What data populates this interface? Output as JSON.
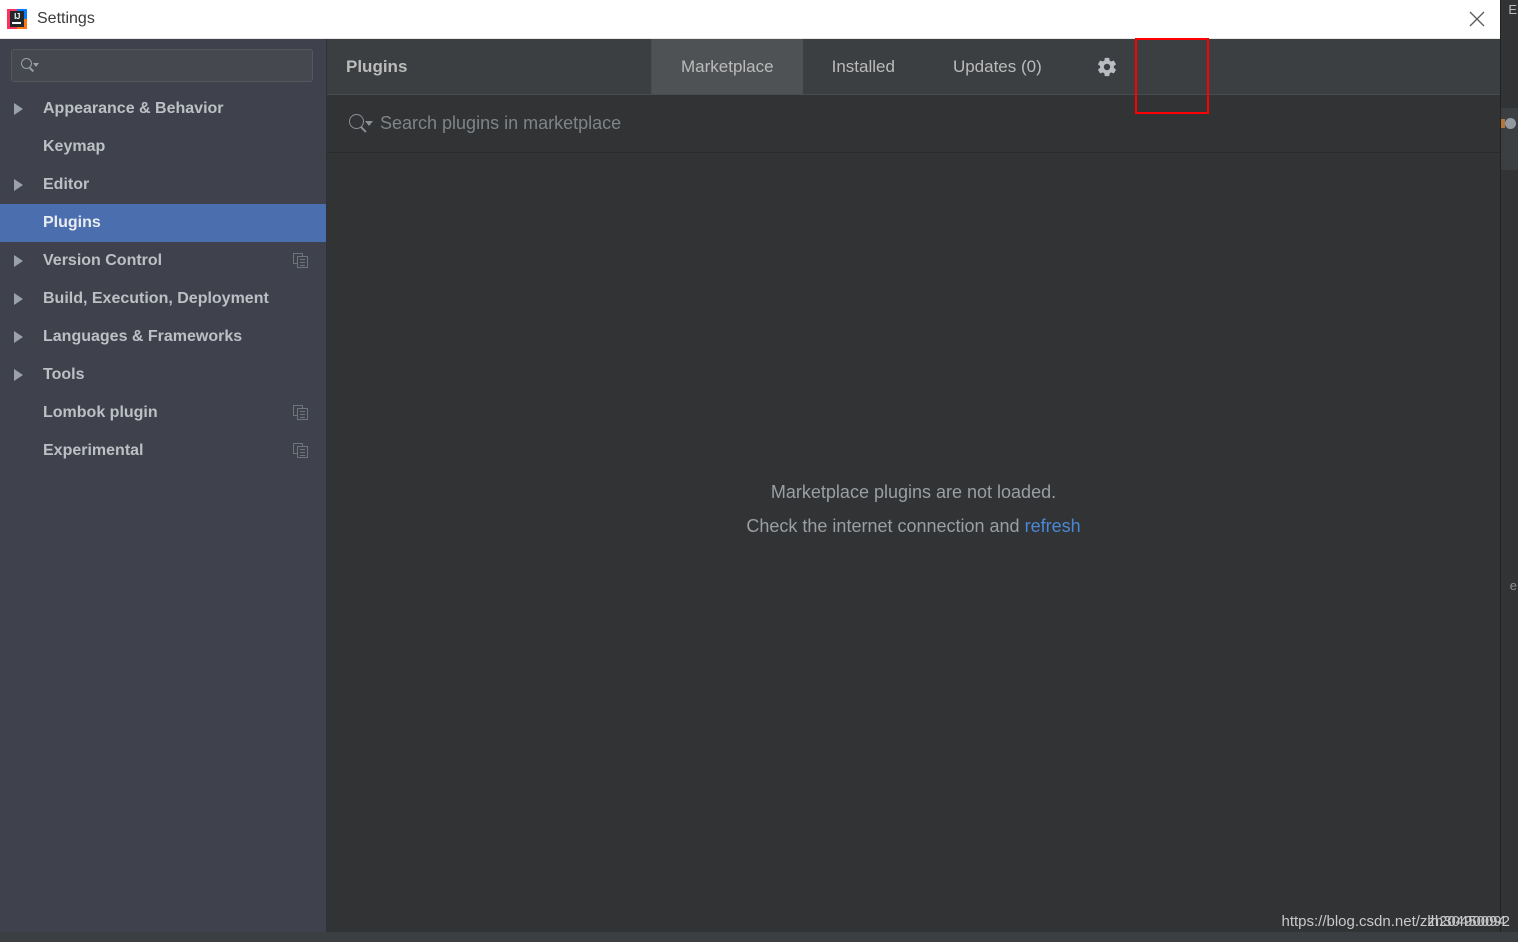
{
  "window": {
    "title": "Settings",
    "logo_icon": "intellij-idea-logo",
    "close_icon": "close-icon"
  },
  "sidebar": {
    "search": {
      "value": "",
      "placeholder": "",
      "icon": "search-icon"
    },
    "items": [
      {
        "label": "Appearance & Behavior",
        "expandable": true,
        "selected": false,
        "copy_icon": false
      },
      {
        "label": "Keymap",
        "expandable": false,
        "selected": false,
        "copy_icon": false
      },
      {
        "label": "Editor",
        "expandable": true,
        "selected": false,
        "copy_icon": false
      },
      {
        "label": "Plugins",
        "expandable": false,
        "selected": true,
        "copy_icon": false
      },
      {
        "label": "Version Control",
        "expandable": true,
        "selected": false,
        "copy_icon": true
      },
      {
        "label": "Build, Execution, Deployment",
        "expandable": true,
        "selected": false,
        "copy_icon": false
      },
      {
        "label": "Languages & Frameworks",
        "expandable": true,
        "selected": false,
        "copy_icon": false
      },
      {
        "label": "Tools",
        "expandable": true,
        "selected": false,
        "copy_icon": false
      },
      {
        "label": "Lombok plugin",
        "expandable": false,
        "selected": false,
        "copy_icon": true
      },
      {
        "label": "Experimental",
        "expandable": false,
        "selected": false,
        "copy_icon": true
      }
    ]
  },
  "main": {
    "title": "Plugins",
    "tabs": [
      {
        "label": "Marketplace",
        "active": true
      },
      {
        "label": "Installed",
        "active": false
      },
      {
        "label": "Updates (0)",
        "active": false
      }
    ],
    "gear_icon": "gear-icon",
    "search": {
      "value": "",
      "placeholder": "Search plugins in marketplace",
      "icon": "search-icon"
    },
    "empty_state": {
      "line1": "Marketplace plugins are not loaded.",
      "line2_prefix": "Check the internet connection and ",
      "line2_link": "refresh"
    }
  },
  "annotation": {
    "highlight_color": "#ff0000",
    "target": "gear-icon"
  },
  "watermark": {
    "text_base": "https://blog.csdn.net/z",
    "text_overlay_a": "zh30450092",
    "text_overlay_b": "lh20490094"
  },
  "colors": {
    "sidebar_bg": "#3f424d",
    "content_bg": "#313335",
    "header_bg": "#3c3f41",
    "selection": "#4b6eaf",
    "link": "#4a88d6",
    "text": "#bbbbbb"
  }
}
